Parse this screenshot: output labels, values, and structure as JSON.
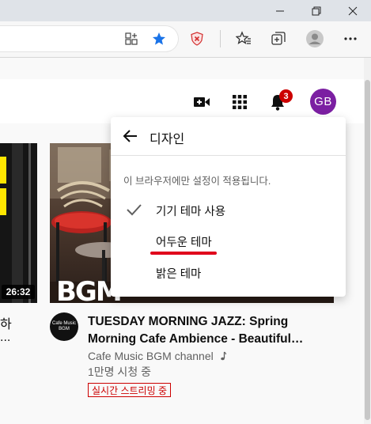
{
  "browser": {
    "window_controls": [
      "minimize-icon",
      "restore-icon",
      "close-icon"
    ],
    "toolbar_icons": [
      "app-available-icon",
      "favorite-star-icon",
      "extension-shield-icon",
      "favorites-list-icon",
      "collections-icon",
      "profile-icon",
      "more-menu-icon"
    ],
    "colors": {
      "star": "#1a73e8",
      "shield": "#d32f2f"
    }
  },
  "header": {
    "icons": [
      "create-video-icon",
      "apps-grid-icon",
      "notifications-bell-icon"
    ],
    "notification_count": "3",
    "avatar_initials": "GB",
    "avatar_color": "#7b1fa2"
  },
  "videos": {
    "left": {
      "duration": "26:32",
      "title_line1": "하",
      "title_line2": "..."
    },
    "main": {
      "thumb_text": "BGM",
      "channel_avatar_text": "Cafe Music BGM",
      "title": "TUESDAY MORNING JAZZ: Spring Morning Cafe Ambience - Beautiful…",
      "channel": "Cafe Music BGM channel",
      "channel_badge_icon": "music-note-icon",
      "views": "1만명 시청 중",
      "live_badge": "실시간 스트리밍 중"
    }
  },
  "menu": {
    "title": "디자인",
    "description": "이 브라우저에만 설정이 적용됩니다.",
    "items": [
      {
        "label": "기기 테마 사용",
        "selected": true
      },
      {
        "label": "어두운 테마",
        "selected": false,
        "highlighted": true
      },
      {
        "label": "밝은 테마",
        "selected": false
      }
    ],
    "accent": "#e0001b"
  }
}
